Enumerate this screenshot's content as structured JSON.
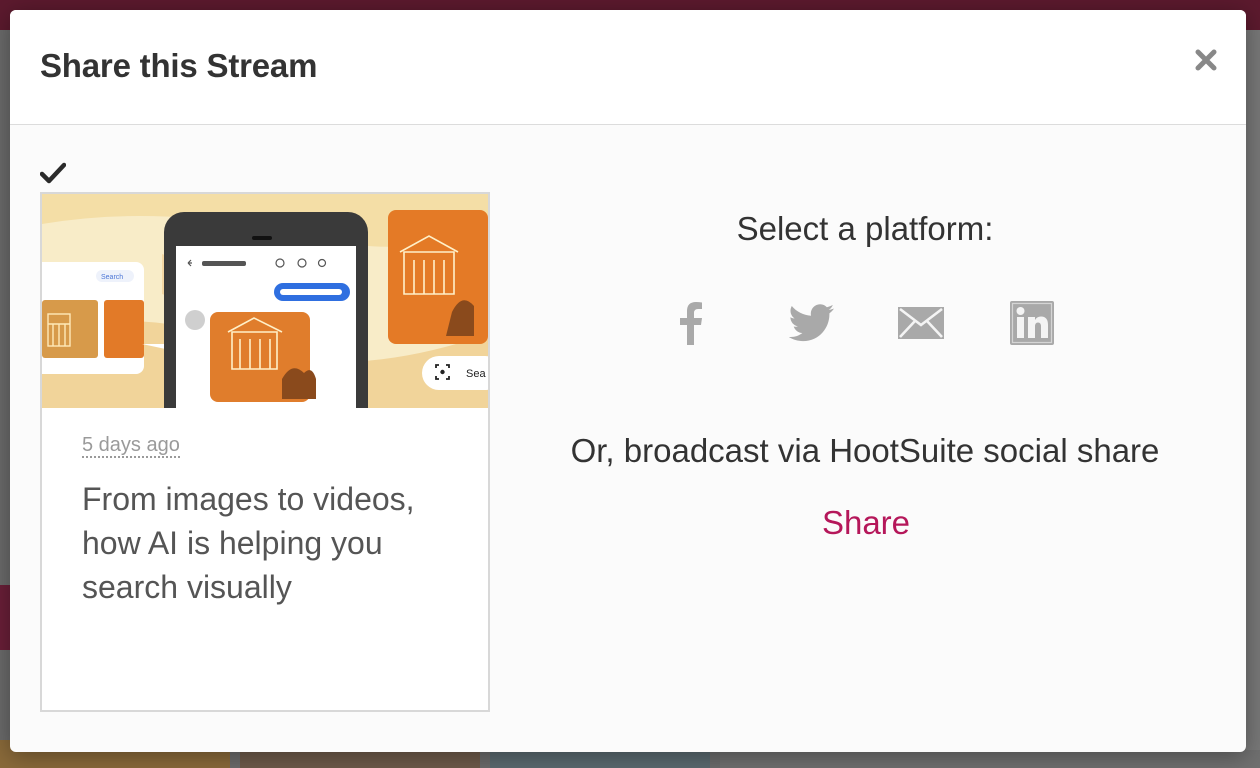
{
  "modal": {
    "title": "Share this Stream",
    "close_icon": "close-icon"
  },
  "card": {
    "selected_icon": "checkmark-icon",
    "timestamp": "5 days ago",
    "title": "From images to videos, how AI is helping you search visually",
    "image": {
      "search_chip": "Search",
      "lens_button": "Sea"
    }
  },
  "share": {
    "platform_heading": "Select a platform:",
    "platforms": [
      {
        "name": "facebook",
        "icon": "facebook-icon"
      },
      {
        "name": "twitter",
        "icon": "twitter-icon"
      },
      {
        "name": "email",
        "icon": "email-icon"
      },
      {
        "name": "linkedin",
        "icon": "linkedin-icon"
      }
    ],
    "broadcast_text": "Or, broadcast via HootSuite social share",
    "share_label": "Share"
  },
  "colors": {
    "accent": "#b5175a",
    "icon_gray": "#a9a9a9",
    "text": "#333333",
    "overlay_bar": "#5c1a2e"
  }
}
